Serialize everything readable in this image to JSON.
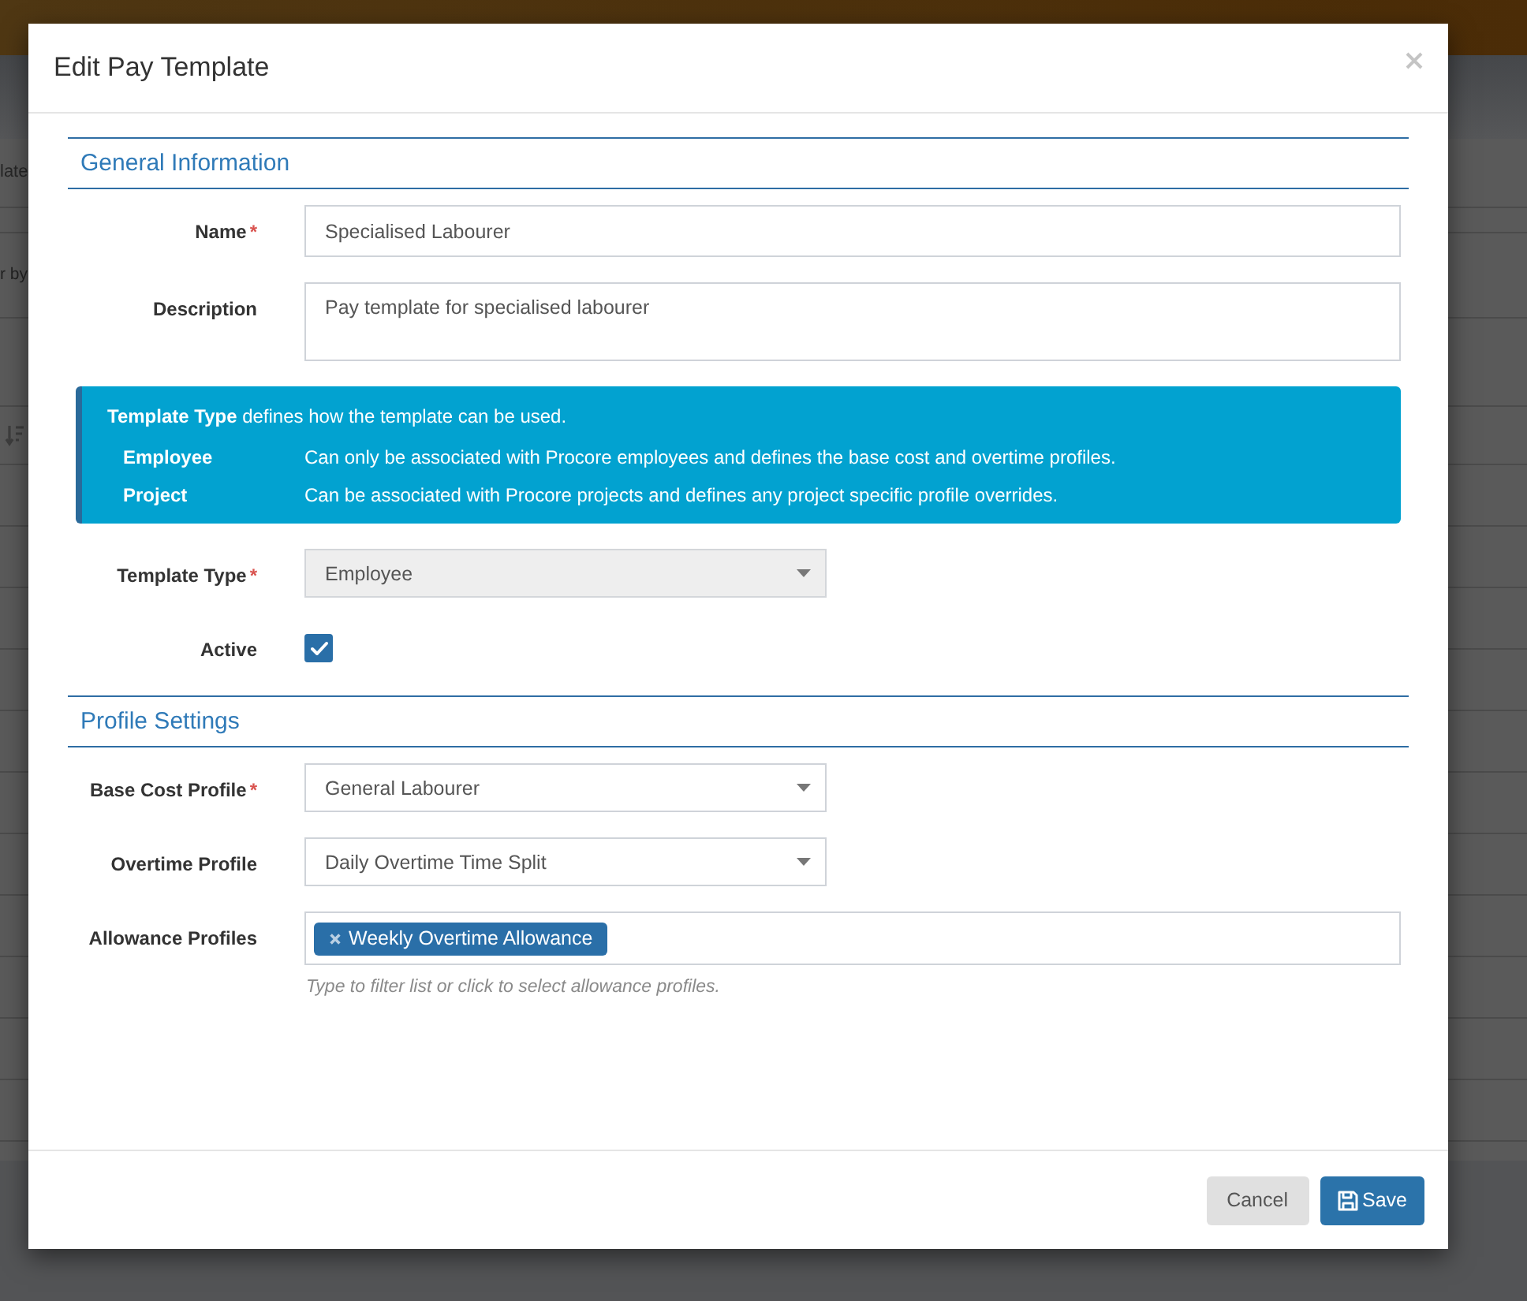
{
  "background": {
    "texts": [
      "late",
      "r by"
    ]
  },
  "dialog": {
    "title": "Edit Pay Template",
    "sections": [
      {
        "title": "General Information",
        "fields": [
          {
            "kind": "text",
            "label": "Name",
            "required_mark": "*",
            "value": "Specialised Labourer"
          },
          {
            "kind": "textarea",
            "label": "Description",
            "value": "Pay template for specialised labourer"
          },
          {
            "kind": "info",
            "heading": "**Template Type** defines how the template can be used.",
            "definitions": [
              {
                "term": "Employee",
                "description": "Can only be associated with Procore employees and defines the base cost and overtime profiles."
              },
              {
                "term": "Project",
                "description": "Can be associated with Procore projects and defines any project specific profile overrides."
              }
            ]
          },
          {
            "kind": "select",
            "label": "Template Type",
            "required_mark": "*",
            "value": "Employee",
            "disabled": true
          },
          {
            "kind": "checkbox",
            "label": "Active",
            "checked": true
          }
        ]
      },
      {
        "title": "Profile Settings",
        "fields": [
          {
            "kind": "select",
            "label": "Base Cost Profile",
            "required_mark": "*",
            "value": "General Labourer",
            "disabled": false
          },
          {
            "kind": "select",
            "label": "Overtime Profile",
            "value": "Daily Overtime Time Split",
            "disabled": false
          },
          {
            "kind": "tags",
            "label": "Allowance Profiles",
            "tags": [
              "Weekly Overtime Allowance"
            ],
            "hint": "Type to filter list or click to select allowance profiles."
          }
        ]
      }
    ],
    "buttons": [
      {
        "kind": "secondary",
        "label": "Cancel"
      },
      {
        "kind": "primary",
        "label": "Save"
      }
    ]
  }
}
